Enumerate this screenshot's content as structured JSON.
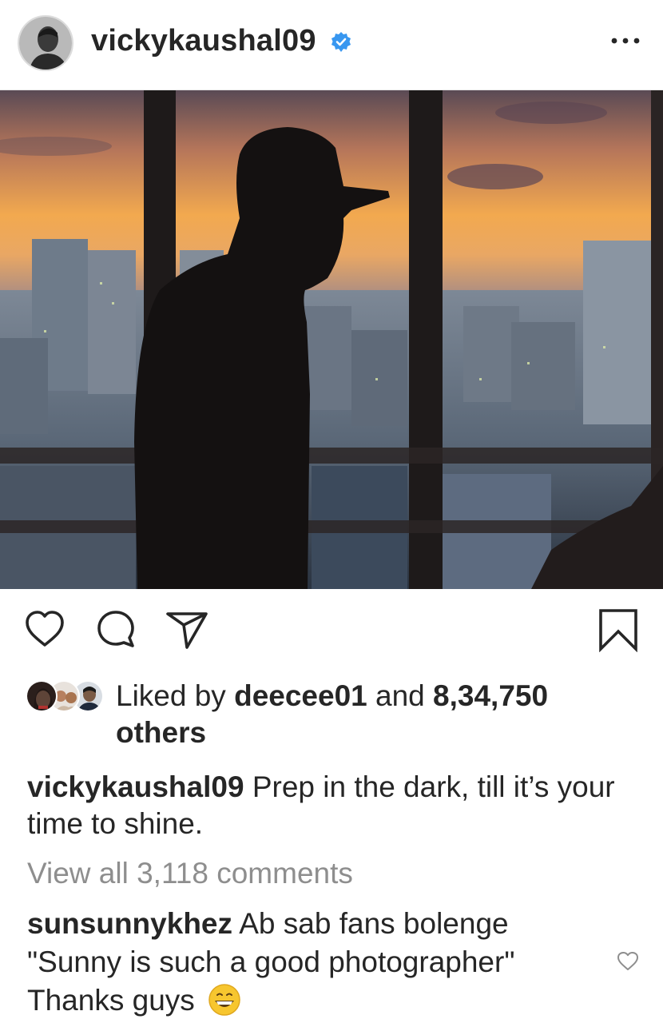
{
  "post": {
    "username": "vickykaushal09",
    "verified": true,
    "more_icon": "more-horizontal-icon"
  },
  "actions": {
    "like_icon": "heart-outline-icon",
    "comment_icon": "comment-bubble-icon",
    "share_icon": "paper-plane-icon",
    "save_icon": "bookmark-outline-icon"
  },
  "likes": {
    "prefix": "Liked by",
    "user": "deecee01",
    "connector": "and",
    "count": "8,34,750",
    "suffix": "others"
  },
  "caption": {
    "username": "vickykaushal09",
    "text": "Prep in the dark, till it’s your time to shine."
  },
  "view_all_comments": "View all 3,118 comments",
  "comment": {
    "username": "sunsunnykhez",
    "text": "Ab sab fans bolenge \"Sunny is such a good photographer\" Thanks guys",
    "emoji": "grinning-face-emoji"
  },
  "colors": {
    "text": "#262626",
    "secondary": "#8e8e8e",
    "verified": "#3897f0"
  }
}
